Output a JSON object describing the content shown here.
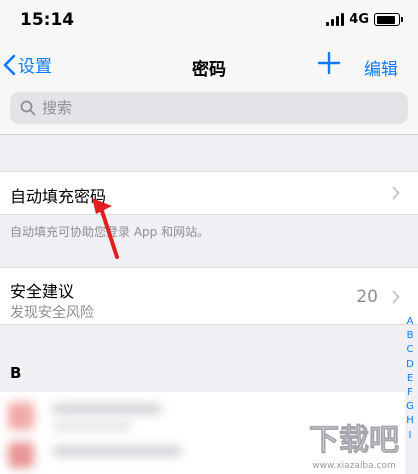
{
  "status_bar": {
    "time": "15:14",
    "network": "4G",
    "battery_level": 0.9
  },
  "nav": {
    "back_label": "设置",
    "title": "密码",
    "edit_label": "编辑"
  },
  "search": {
    "placeholder": "搜索"
  },
  "autofill": {
    "label": "自动填充密码",
    "footnote": "自动填充可协助您登录 App 和网站。"
  },
  "security": {
    "label": "安全建议",
    "subtitle": "发现安全风险",
    "count": "20"
  },
  "section_header": "B",
  "index_letters": [
    "A",
    "B",
    "C",
    "D",
    "E",
    "F",
    "G",
    "H",
    "I"
  ],
  "watermark": {
    "text": "下载吧",
    "url": "www.xiazaiba.com"
  },
  "colors": {
    "accent": "#0a7aff",
    "annotation": "#e02020"
  }
}
